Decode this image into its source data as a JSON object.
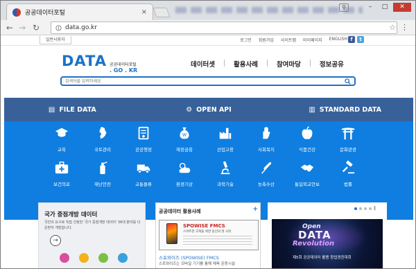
{
  "browser": {
    "tab_title": "공공데이터포털",
    "tab_close": "×",
    "url": "data.go.kr",
    "user_pill": "⚲",
    "back": "←",
    "forward": "→",
    "reload": "↻",
    "star": "☆",
    "menu": "⋮",
    "win_min": "–",
    "win_max": "□",
    "win_close": "✕"
  },
  "header": {
    "gnb_tab": "일반사용자",
    "util_links": [
      "로그인",
      "회원가입",
      "사이트맵",
      "마이페이지",
      "ENGLISH"
    ],
    "sns": [
      "f",
      "t"
    ],
    "logo_big": "DATA",
    "logo_ko": "공공데이터포털",
    "logo_en": ". GO . KR",
    "main_nav": [
      "데이터셋",
      "활용사례",
      "참여마당",
      "정보공유"
    ]
  },
  "search": {
    "placeholder": "검색어를 입력하세요",
    "icon": "search-icon"
  },
  "data_tabs": [
    {
      "label": "FILE DATA",
      "icon": "▤"
    },
    {
      "label": "OPEN API",
      "icon": "⚙"
    },
    {
      "label": "STANDARD DATA",
      "icon": "▥"
    }
  ],
  "categories": {
    "row1": [
      "교육",
      "국토관리",
      "공공행정",
      "재정금융",
      "산업고용",
      "사회복지",
      "식품건강",
      "문화관광"
    ],
    "row2": [
      "보건의료",
      "재난안전",
      "교통물류",
      "환경기상",
      "과학기술",
      "농축수산",
      "통일외교안보",
      "법률"
    ]
  },
  "panel_open": {
    "title": "국가 중점개방 데이터",
    "desc": "국민의 요구로 직접 선정한 '국가 중점개방 데이터' 36대 분야를 다운받아 개방합니다.",
    "arrow": "→",
    "dot_colors": [
      "#d94f9e",
      "#f2b21a",
      "#7ac143",
      "#3aa0de"
    ]
  },
  "panel_cases": {
    "title": "공공데이터 활용사례",
    "plus": "+",
    "ad_brand": "SPOWISE FMCS",
    "ad_sub": "스마트한 고객을 위한 당신의 첫 시작",
    "link": "스포와이즈 (SPOWISE) FMCS",
    "desc": "스포와이즈는 모바일 기기를 통해 체육 운동시설"
  },
  "panel_banner": {
    "pager": [
      "‖"
    ],
    "img_open": "Open",
    "img_data": "DATA",
    "img_rev": "Revolution",
    "caption": "제5회 공공데이터 활용 창업경진대회"
  },
  "colors": {
    "accent": "#1b73c7",
    "tab_bar": "#38619a",
    "category_bg": "#0f7ee0"
  }
}
